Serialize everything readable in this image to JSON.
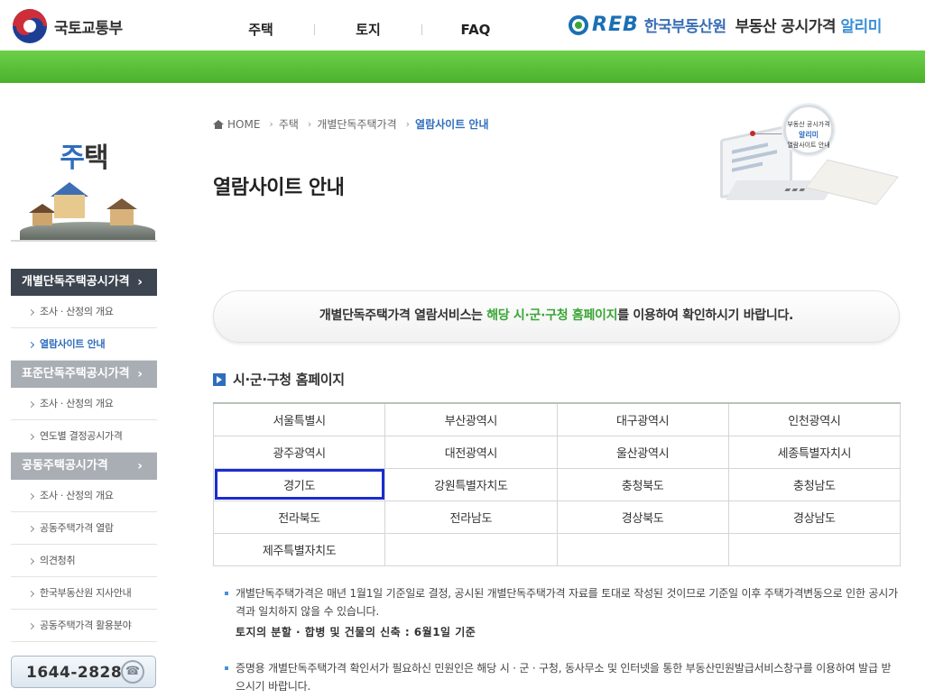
{
  "header": {
    "ministry_name": "국토교통부",
    "nav": [
      "주택",
      "토지",
      "FAQ"
    ],
    "reb_logo_text": "REB",
    "reb_org_name": "한국부동산원",
    "service_name_prefix": "부동산 공시가격",
    "service_name_accent": "알리미"
  },
  "sidebar": {
    "title_first": "주",
    "title_rest": "택",
    "menus": [
      {
        "label": "개별단독주택공시가격",
        "state": "active",
        "items": [
          {
            "label": "조사 · 산정의 개요"
          },
          {
            "label": "열람사이트 안내",
            "current": true
          }
        ]
      },
      {
        "label": "표준단독주택공시가격",
        "state": "inactive",
        "items": [
          {
            "label": "조사 · 산정의 개요"
          },
          {
            "label": "연도별 결정공시가격"
          }
        ]
      },
      {
        "label": "공동주택공시가격",
        "state": "inactive",
        "items": [
          {
            "label": "조사 · 산정의 개요"
          },
          {
            "label": "공동주택가격 열람"
          },
          {
            "label": "의견청취"
          },
          {
            "label": "한국부동산원 지사안내"
          },
          {
            "label": "공동주택가격 활용분야"
          }
        ]
      }
    ],
    "call_number": "1644-2828"
  },
  "breadcrumb": [
    "HOME",
    "주택",
    "개별단독주택가격",
    "열람사이트 안내"
  ],
  "page_title": "열람사이트 안내",
  "visual": {
    "magnifier_line1": "부동산 공시가격",
    "magnifier_service": "알리미",
    "magnifier_line2": "열람사이트 안내"
  },
  "notice": {
    "before": "개별단독주택가격 열람서비스는 ",
    "highlight": "해당 시·군·구청 홈페이지",
    "after": "를 이용하여 확인하시기 바랍니다."
  },
  "section_title": "시·군·구청 홈페이지",
  "regions": [
    [
      "서울특별시",
      "부산광역시",
      "대구광역시",
      "인천광역시"
    ],
    [
      "광주광역시",
      "대전광역시",
      "울산광역시",
      "세종특별자치시"
    ],
    [
      "경기도",
      "강원특별자치도",
      "충청북도",
      "충청남도"
    ],
    [
      "전라북도",
      "전라남도",
      "경상북도",
      "경상남도"
    ],
    [
      "제주특별자치도",
      "",
      "",
      ""
    ]
  ],
  "selected_region": "경기도",
  "notes": {
    "note1": "개별단독주택가격은 매년 1월1일 기준일로 결정, 공시된 개별단독주택가격 자료를 토대로 작성된 것이므로 기준일 이후 주택가격변동으로 인한 공시가격과 일치하지 않을 수 있습니다.",
    "note1_strong": "토지의 분할 · 합병 및 건물의 신축 : 6월1일 기준",
    "note2": "증명용 개별단독주택가격 확인서가 필요하신 민원인은 해당 시 · 군 · 구청, 동사무소 및 인터넷을 통한 부동산민원발급서비스창구를 이용하여 발급 받으시기 바랍니다."
  },
  "colors": {
    "green_bar": "#4bb12d",
    "accent_blue": "#2e6ebd",
    "highlight_green": "#3aa635",
    "selected_outline": "#1a2ccf"
  }
}
